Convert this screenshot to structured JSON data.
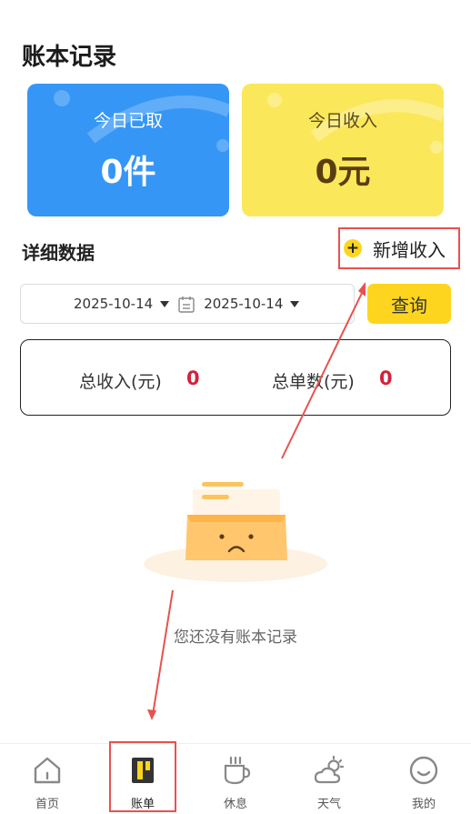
{
  "page": {
    "title": "账本记录"
  },
  "cards": [
    {
      "label": "今日已取",
      "value": "0件"
    },
    {
      "label": "今日收入",
      "value": "0元"
    }
  ],
  "details": {
    "title": "详细数据",
    "add_income_label": "新增收入",
    "add_income_icon": "+",
    "start_date": "2025-10-14",
    "end_date": "2025-10-14",
    "query_label": "查询"
  },
  "summary": {
    "total_income_label": "总收入(元)",
    "total_income_value": "0",
    "total_orders_label": "总单数(元)",
    "total_orders_value": "0"
  },
  "empty_state": {
    "message": "您还没有账本记录"
  },
  "nav": {
    "active": "账单",
    "items": [
      {
        "label": "首页",
        "icon": "home-icon"
      },
      {
        "label": "账单",
        "icon": "ledger-icon"
      },
      {
        "label": "休息",
        "icon": "coffee-cup-icon"
      },
      {
        "label": "天气",
        "icon": "weather-cloud-sun-icon"
      },
      {
        "label": "我的",
        "icon": "smiley-face-icon"
      }
    ]
  },
  "colors": {
    "blue_card": "#3696f6",
    "yellow_card": "#fbe85a",
    "accent_yellow": "#fdd51f",
    "value_red": "#d4213c",
    "annotation_red": "#e8514f"
  }
}
